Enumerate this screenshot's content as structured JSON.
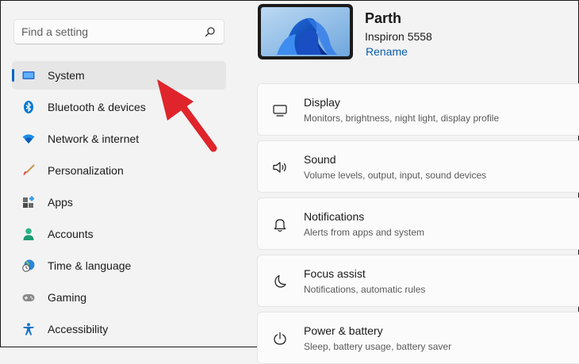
{
  "search": {
    "placeholder": "Find a setting"
  },
  "sidebar": {
    "items": [
      {
        "label": "System",
        "icon": "system-icon",
        "active": true
      },
      {
        "label": "Bluetooth & devices",
        "icon": "bluetooth-icon"
      },
      {
        "label": "Network & internet",
        "icon": "wifi-icon"
      },
      {
        "label": "Personalization",
        "icon": "brush-icon"
      },
      {
        "label": "Apps",
        "icon": "apps-icon"
      },
      {
        "label": "Accounts",
        "icon": "account-icon"
      },
      {
        "label": "Time & language",
        "icon": "globe-clock-icon"
      },
      {
        "label": "Gaming",
        "icon": "gamepad-icon"
      },
      {
        "label": "Accessibility",
        "icon": "accessibility-icon"
      }
    ]
  },
  "device": {
    "name": "Parth",
    "model": "Inspiron 5558",
    "rename": "Rename"
  },
  "settings": [
    {
      "title": "Display",
      "subtitle": "Monitors, brightness, night light, display profile",
      "icon": "display-icon"
    },
    {
      "title": "Sound",
      "subtitle": "Volume levels, output, input, sound devices",
      "icon": "speaker-icon"
    },
    {
      "title": "Notifications",
      "subtitle": "Alerts from apps and system",
      "icon": "bell-icon"
    },
    {
      "title": "Focus assist",
      "subtitle": "Notifications, automatic rules",
      "icon": "moon-icon"
    },
    {
      "title": "Power & battery",
      "subtitle": "Sleep, battery usage, battery saver",
      "icon": "power-icon"
    }
  ],
  "colors": {
    "accent": "#0067c0",
    "link": "#0a5fad",
    "arrow": "#e0242b"
  }
}
